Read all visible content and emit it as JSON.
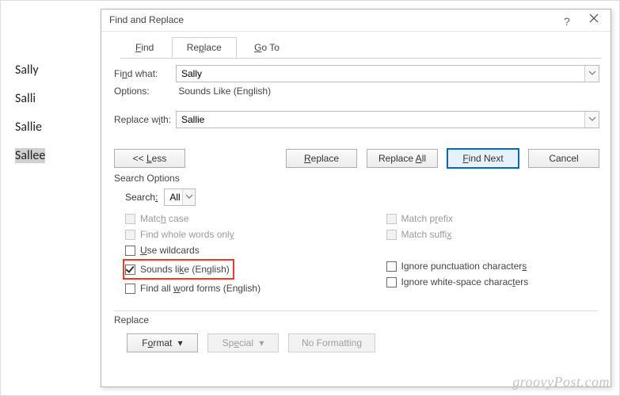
{
  "document": {
    "words": [
      "Sally",
      "Salli",
      "Sallie",
      "Sallee"
    ],
    "selected_index": 3
  },
  "dialog": {
    "title": "Find and Replace",
    "tabs": {
      "find": "Find",
      "replace": "Replace",
      "goto": "Go To",
      "active": "replace"
    },
    "find_what_label": "Find what:",
    "find_what_value": "Sally",
    "options_label": "Options:",
    "options_value": "Sounds Like (English)",
    "replace_with_label": "Replace with:",
    "replace_with_value": "Sallie",
    "buttons": {
      "less": "<< Less",
      "replace": "Replace",
      "replace_all": "Replace All",
      "find_next": "Find Next",
      "cancel": "Cancel"
    },
    "search_options_title": "Search Options",
    "search_label": "Search:",
    "search_direction": "All",
    "checks_left": {
      "match_case": {
        "label_pre": "Matc",
        "u": "h",
        "label_post": " case",
        "checked": false,
        "disabled": true
      },
      "whole_words": {
        "label_pre": "Find whole words onl",
        "u": "y",
        "label_post": "",
        "checked": false,
        "disabled": true
      },
      "use_wildcards": {
        "label_pre": "",
        "u": "U",
        "label_post": "se wildcards",
        "checked": false,
        "disabled": false
      },
      "sounds_like": {
        "label_pre": "Sounds li",
        "u": "k",
        "label_post": "e (English)",
        "checked": true,
        "disabled": false
      },
      "all_word_forms": {
        "label_pre": "Find all ",
        "u": "w",
        "label_post": "ord forms (English)",
        "checked": false,
        "disabled": false
      }
    },
    "checks_right": {
      "match_prefix": {
        "label_pre": "Match p",
        "u": "r",
        "label_post": "efix",
        "checked": false,
        "disabled": true
      },
      "match_suffix": {
        "label_pre": "Match suffi",
        "u": "x",
        "label_post": "",
        "checked": false,
        "disabled": true
      },
      "ignore_punct": {
        "label_pre": "Ignore punctuation character",
        "u": "s",
        "label_post": "",
        "checked": false,
        "disabled": false
      },
      "ignore_whitespace": {
        "label_pre": "Ignore white-space charac",
        "u": "t",
        "label_post": "ers",
        "checked": false,
        "disabled": false
      }
    },
    "replace_section_title": "Replace",
    "bottom": {
      "format": "Format",
      "special": "Special",
      "no_formatting": "No Formatting"
    }
  },
  "watermark": "groovyPost.com"
}
